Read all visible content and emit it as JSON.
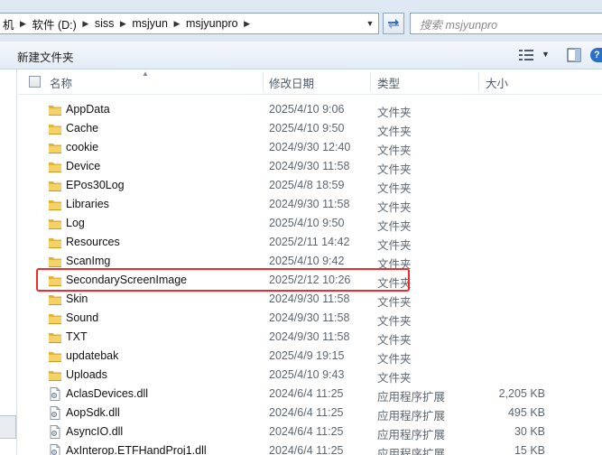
{
  "address_bar": {
    "crumbs": [
      "机",
      "软件 (D:)",
      "siss",
      "msjyun",
      "msjyunpro"
    ]
  },
  "search": {
    "placeholder": "搜索 msjyunpro"
  },
  "toolbar": {
    "new_folder_label": "新建文件夹"
  },
  "columns": {
    "name": "名称",
    "date": "修改日期",
    "type": "类型",
    "size": "大小"
  },
  "files": [
    {
      "name": "AppData",
      "date": "2025/4/10 9:06",
      "type": "文件夹",
      "size": "",
      "kind": "folder"
    },
    {
      "name": "Cache",
      "date": "2025/4/10 9:50",
      "type": "文件夹",
      "size": "",
      "kind": "folder"
    },
    {
      "name": "cookie",
      "date": "2024/9/30 12:40",
      "type": "文件夹",
      "size": "",
      "kind": "folder"
    },
    {
      "name": "Device",
      "date": "2024/9/30 11:58",
      "type": "文件夹",
      "size": "",
      "kind": "folder"
    },
    {
      "name": "EPos30Log",
      "date": "2025/4/8 18:59",
      "type": "文件夹",
      "size": "",
      "kind": "folder"
    },
    {
      "name": "Libraries",
      "date": "2024/9/30 11:58",
      "type": "文件夹",
      "size": "",
      "kind": "folder"
    },
    {
      "name": "Log",
      "date": "2025/4/10 9:50",
      "type": "文件夹",
      "size": "",
      "kind": "folder"
    },
    {
      "name": "Resources",
      "date": "2025/2/11 14:42",
      "type": "文件夹",
      "size": "",
      "kind": "folder"
    },
    {
      "name": "ScanImg",
      "date": "2025/4/10 9:42",
      "type": "文件夹",
      "size": "",
      "kind": "folder"
    },
    {
      "name": "SecondaryScreenImage",
      "date": "2025/2/12 10:26",
      "type": "文件夹",
      "size": "",
      "kind": "folder",
      "highlighted": true
    },
    {
      "name": "Skin",
      "date": "2024/9/30 11:58",
      "type": "文件夹",
      "size": "",
      "kind": "folder"
    },
    {
      "name": "Sound",
      "date": "2024/9/30 11:58",
      "type": "文件夹",
      "size": "",
      "kind": "folder"
    },
    {
      "name": "TXT",
      "date": "2024/9/30 11:58",
      "type": "文件夹",
      "size": "",
      "kind": "folder"
    },
    {
      "name": "updatebak",
      "date": "2025/4/9 19:15",
      "type": "文件夹",
      "size": "",
      "kind": "folder"
    },
    {
      "name": "Uploads",
      "date": "2025/4/10 9:43",
      "type": "文件夹",
      "size": "",
      "kind": "folder"
    },
    {
      "name": "AclasDevices.dll",
      "date": "2024/6/4 11:25",
      "type": "应用程序扩展",
      "size": "2,205 KB",
      "kind": "dll"
    },
    {
      "name": "AopSdk.dll",
      "date": "2024/6/4 11:25",
      "type": "应用程序扩展",
      "size": "495 KB",
      "kind": "dll"
    },
    {
      "name": "AsyncIO.dll",
      "date": "2024/6/4 11:25",
      "type": "应用程序扩展",
      "size": "30 KB",
      "kind": "dll"
    },
    {
      "name": "AxInterop.ETFHandProj1.dll",
      "date": "2024/6/4 11:25",
      "type": "应用程序扩展",
      "size": "15 KB",
      "kind": "dll"
    }
  ],
  "colors": {
    "highlight_border": "#ef2b2b",
    "folder_yellow": "#f2c94c"
  }
}
